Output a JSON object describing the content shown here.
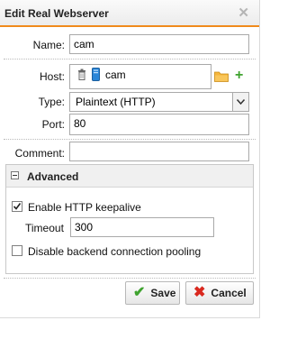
{
  "dialog": {
    "title": "Edit Real Webserver",
    "close_icon": "close-icon"
  },
  "fields": {
    "name": {
      "label": "Name:",
      "value": "cam"
    },
    "host": {
      "label": "Host:",
      "value": "cam"
    },
    "type": {
      "label": "Type:",
      "value": "Plaintext (HTTP)"
    },
    "port": {
      "label": "Port:",
      "value": "80"
    },
    "comment": {
      "label": "Comment:",
      "value": ""
    }
  },
  "advanced": {
    "title": "Advanced",
    "keepalive": {
      "label": "Enable HTTP keepalive",
      "checked": true
    },
    "timeout": {
      "label": "Timeout",
      "value": "300"
    },
    "pooling": {
      "label": "Disable backend connection pooling",
      "checked": false
    }
  },
  "buttons": {
    "save": "Save",
    "cancel": "Cancel"
  },
  "colors": {
    "accent": "#f08a1c",
    "save": "#3fa32f",
    "cancel": "#d9281e"
  }
}
